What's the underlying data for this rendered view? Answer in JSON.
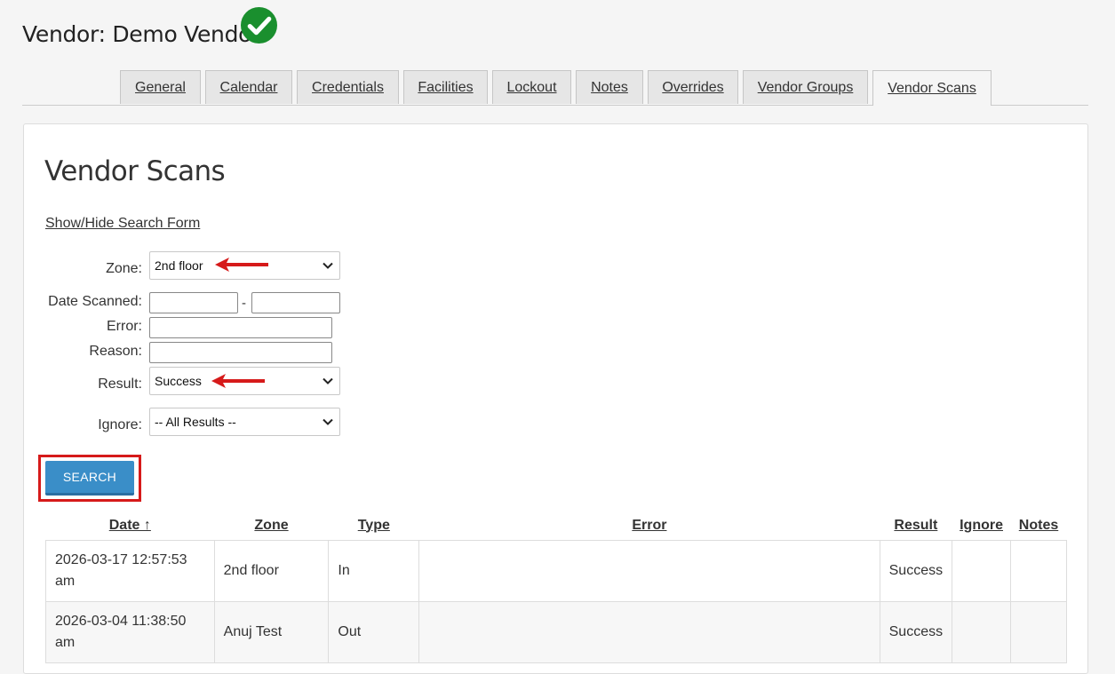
{
  "header": {
    "title": "Vendor: Demo Vendor"
  },
  "tabs": [
    "General",
    "Calendar",
    "Credentials",
    "Facilities",
    "Lockout",
    "Notes",
    "Overrides",
    "Vendor Groups",
    "Vendor Scans"
  ],
  "active_tab": "Vendor Scans",
  "section": {
    "title": "Vendor Scans",
    "toggle_link": "Show/Hide Search Form"
  },
  "form": {
    "zone_label": "Zone:",
    "zone_value": "2nd floor",
    "date_label": "Date Scanned:",
    "date_from": "",
    "date_to": "",
    "date_separator": "-",
    "error_label": "Error:",
    "error_value": "",
    "reason_label": "Reason:",
    "reason_value": "",
    "result_label": "Result:",
    "result_value": "Success",
    "ignore_label": "Ignore:",
    "ignore_value": "-- All Results --",
    "search_button": "SEARCH"
  },
  "table": {
    "headers": [
      "Date ↑",
      "Zone",
      "Type",
      "Error",
      "Result",
      "Ignore",
      "Notes"
    ],
    "rows": [
      {
        "date": "2026-03-17 12:57:53 am",
        "zone": "2nd floor",
        "type": "In",
        "error": "",
        "result": "Success",
        "ignore": "",
        "notes": ""
      },
      {
        "date": "2026-03-04 11:38:50 am",
        "zone": "Anuj Test",
        "type": "Out",
        "error": "",
        "result": "Success",
        "ignore": "",
        "notes": ""
      }
    ]
  },
  "colors": {
    "accent": "#3a8ec8",
    "annotation": "#d61a1a",
    "success": "#1a8f2e"
  }
}
